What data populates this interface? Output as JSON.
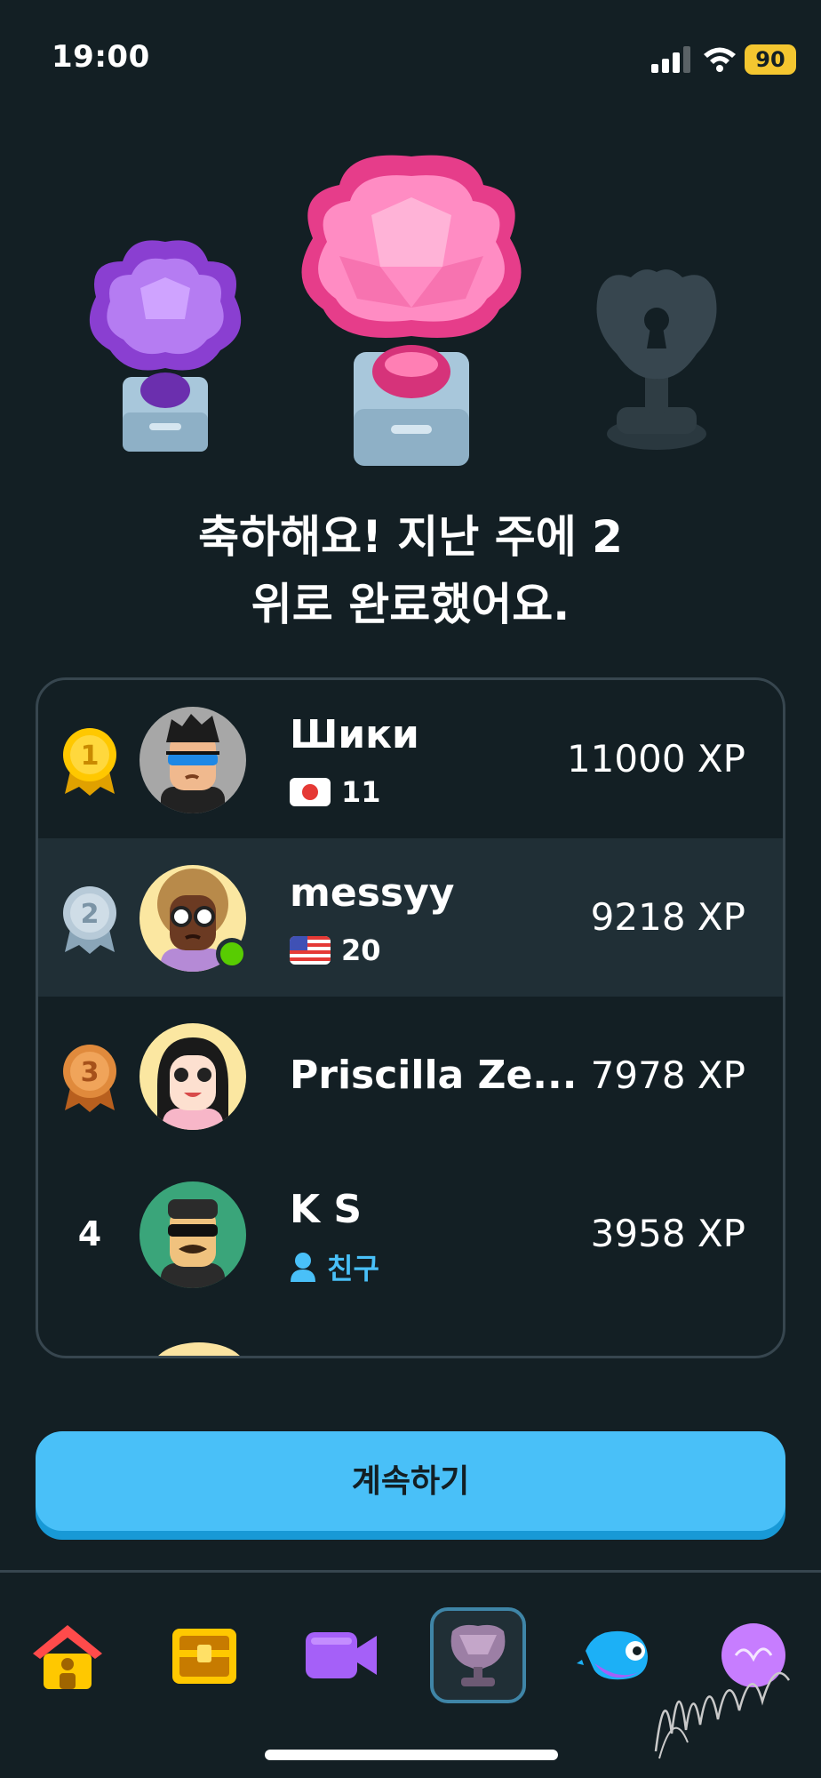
{
  "status": {
    "time": "19:00",
    "battery": "90"
  },
  "title": {
    "line1": "축하해요! 지난 주에 2",
    "line2": "위로 완료했어요."
  },
  "leaderboard": [
    {
      "rank": "1",
      "rank_style": "gold-medal",
      "name": "Шики",
      "flag": "japan-flag",
      "streak": "11",
      "xp": "11000 XP"
    },
    {
      "rank": "2",
      "rank_style": "silver-medal",
      "name": "messyy",
      "flag": "us-flag",
      "streak": "20",
      "xp": "9218 XP",
      "highlighted": true,
      "online": true
    },
    {
      "rank": "3",
      "rank_style": "bronze-medal",
      "name": "Priscilla Ze...",
      "xp": "7978 XP"
    },
    {
      "rank": "4",
      "name": "K S",
      "friend_label": "친구",
      "xp": "3958 XP"
    }
  ],
  "continue_button": "계속하기",
  "nav": [
    {
      "icon": "home-icon",
      "active": false
    },
    {
      "icon": "treasure-chest-icon",
      "active": false
    },
    {
      "icon": "video-icon",
      "active": false
    },
    {
      "icon": "leaderboard-trophy-icon",
      "active": true
    },
    {
      "icon": "duo-character-icon",
      "active": false
    },
    {
      "icon": "profile-icon",
      "active": false
    }
  ],
  "colors": {
    "background": "#131f24",
    "accent": "#49c0f8",
    "highlight_row": "#202f36",
    "friend": "#49c0f8"
  }
}
